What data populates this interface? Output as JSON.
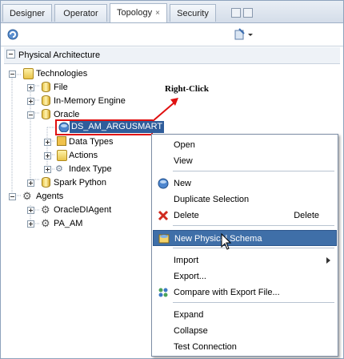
{
  "tabs": [
    {
      "label": "Designer"
    },
    {
      "label": "Operator"
    },
    {
      "label": "Topology",
      "close": "×"
    },
    {
      "label": "Security"
    }
  ],
  "section": {
    "title": "Physical Architecture"
  },
  "tree": {
    "technologies": "Technologies",
    "file": "File",
    "inmemory": "In-Memory Engine",
    "oracle": "Oracle",
    "selected_server": "DS_AM_ARGUSMART",
    "data_types": "Data Types",
    "actions": "Actions",
    "index_type": "Index Type",
    "spark": "Spark Python",
    "agents": "Agents",
    "agent1": "OracleDIAgent",
    "agent2": "PA_AM"
  },
  "annotation": {
    "label": "Right-Click",
    "color": "#e01010"
  },
  "context_menu": {
    "open": "Open",
    "view": "View",
    "new": "New",
    "duplicate": "Duplicate Selection",
    "delete": "Delete",
    "delete_shortcut": "Delete",
    "new_physical_schema": "New Physical Schema",
    "import": "Import",
    "export": "Export...",
    "compare": "Compare with Export File...",
    "expand": "Expand",
    "collapse": "Collapse",
    "test_connection": "Test Connection"
  },
  "colors": {
    "highlight": "#3f6fa8",
    "selection_border": "#e01010",
    "selected_bg": "#2f5d9b"
  }
}
